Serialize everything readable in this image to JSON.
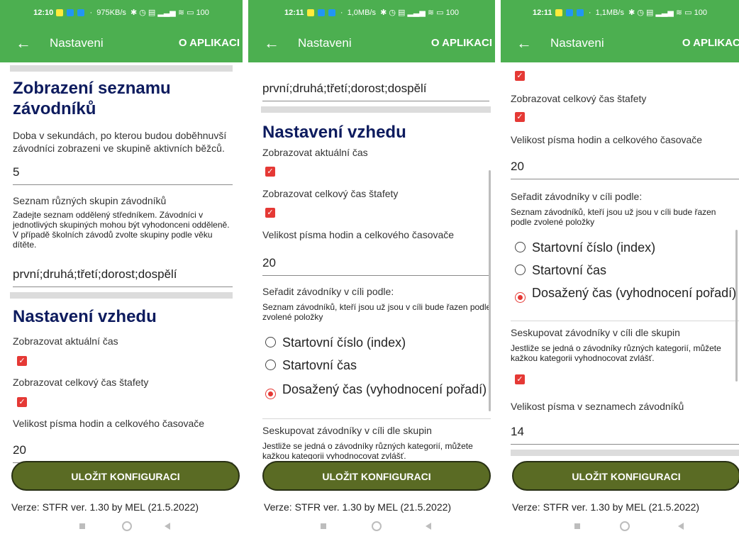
{
  "app": {
    "title": "Nastaveni",
    "about_label": "O APLIKACI"
  },
  "status_bars": [
    {
      "time": "12:10",
      "speed": "975KB/s",
      "battery": "100"
    },
    {
      "time": "12:11",
      "speed": "1,0MB/s",
      "battery": "100"
    },
    {
      "time": "12:11",
      "speed": "1,1MB/s",
      "battery": "100"
    }
  ],
  "sections": {
    "list_display": {
      "heading": "Zobrazení seznamu závodníků",
      "duration_desc": "Doba v sekundách, po kterou budou doběhnuvší závodníci zobrazeni ve skupině aktivních běžců.",
      "duration_value": "5",
      "groups_label": "Seznam různých skupin závodníků",
      "groups_desc": "Zadejte seznam oddělený středníkem. Závodníci v jednotlivých skupiných mohou být vyhodonceni odděleně. V případě školních závodů zvolte skupiny podle věku dítěte.",
      "groups_value": "první;druhá;třetí;dorost;dospělí"
    },
    "appearance": {
      "heading": "Nastavení vzhedu",
      "show_time_label": "Zobrazovat aktuální čas",
      "show_time_checked": true,
      "show_relay_label": "Zobrazovat celkový čas štafety",
      "show_relay_checked": true,
      "font_size_label": "Velikost písma hodin a celkového časovače",
      "font_size_value": "20"
    },
    "sorting": {
      "label": "Seřadit závodníky v cíli podle:",
      "desc": "Seznam závodníků, kteří jsou už jsou v cíli bude řazen podle zvolené položky",
      "options": [
        "Startovní číslo (index)",
        "Startovní čas",
        "Dosažený čas (vyhodnocení pořadí)"
      ],
      "selected_index": 2
    },
    "grouping": {
      "label": "Seskupovat závodníky v cíli dle skupin",
      "desc": "Jestliže se jedná o závodníky různých kategorií, můžete kažkou kategorii vyhodnocovat zvlášť.",
      "desc_cut": "kažkou kategorii vyhodnocovat zvlášť",
      "checked": true
    },
    "list_font": {
      "label": "Velikost písma v seznamech závodníků",
      "value": "14"
    }
  },
  "save_button": "ULOŽIT KONFIGURACI",
  "version": "Verze: STFR ver. 1.30 by MEL (21.5.2022)",
  "icons": [
    "back-arrow-icon",
    "checkbox-checked-icon",
    "radio-icon",
    "nav-recent-icon",
    "nav-home-icon",
    "nav-back-icon"
  ],
  "colors": {
    "appbar": "#4caf50",
    "heading": "#0d1b5e",
    "checkbox": "#e53935",
    "button": "#5a6b24"
  }
}
